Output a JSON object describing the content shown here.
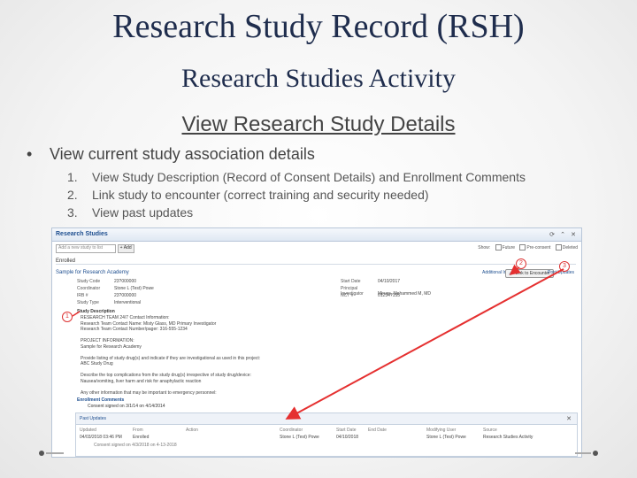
{
  "slide": {
    "title": "Research Study Record (RSH)",
    "subtitle": "Research Studies Activity",
    "section": "View Research Study Details",
    "bullet": "View current study association details",
    "items": [
      {
        "num": "1.",
        "text": "View Study Description (Record of Consent Details) and Enrollment Comments"
      },
      {
        "num": "2.",
        "text": "Link study to encounter (correct training and security needed)"
      },
      {
        "num": "3.",
        "text": "View past updates"
      }
    ]
  },
  "panel": {
    "title": "Research Studies",
    "refresh": "⟳",
    "collapse": "⌃",
    "close": "✕",
    "add_placeholder": "Add a new study to list",
    "add_label": "+ Add",
    "show_label": "Show:",
    "filters": [
      "Future",
      "Pre-consent",
      "Deleted"
    ],
    "enrolled": "Enrolled",
    "study_name": "Sample for Research Academy",
    "additional_info": "Additional Info",
    "link_encounter": "Link to Encounter",
    "post_updates": "Post Updates",
    "left_fields": [
      {
        "k": "Study Code",
        "v": "23?000000"
      },
      {
        "k": "Coordinator",
        "v": "Stone L (Test) Powe"
      },
      {
        "k": "IRB #",
        "v": "23?000000"
      },
      {
        "k": "Study Type",
        "v": "Interventional"
      }
    ],
    "right_fields": [
      {
        "k": "Start Date",
        "v": "04/10/2017"
      },
      {
        "k": "Principal Investigator",
        "v": "Mirves, Mohammed M, MD"
      },
      {
        "k": "NCT #",
        "v": "01234?155"
      }
    ],
    "desc_label": "Study Description",
    "desc_lines": [
      "RESEARCH TEAM 24/7 Contact Information:",
      "Research Team Contact Name: Misty Glass, MD Primary Investigator",
      "Research Team Contact Number/pager: 316-555-1234",
      "",
      "PROJECT INFORMATION:",
      "Sample for Research Academy",
      "",
      "Provide listing of study drug(s) and indicate if they are investigational as used in this project:",
      "ABC Study Drug",
      "",
      "Describe the top complications from the study drug(s) irrespective of study drug/device:",
      "Nausea/vomiting, liver harm and risk for anaphylactic reaction",
      "",
      "Any other information that may be important to emergency personnel:",
      "NA"
    ],
    "enroll_comments": "Enrollment Comments",
    "consent": "Consent signed on 3/1/14 on 4/14/2014",
    "past_updates": {
      "title": "Past Updates",
      "close": "✕",
      "columns": [
        "Updated",
        "From",
        "Action",
        "Coordinator",
        "Start Date",
        "End Date",
        "Modifying User",
        "Source"
      ],
      "values": [
        "04/03/2018 03:46 PM",
        "Enrolled",
        "",
        "Stone L (Test) Powe",
        "04/10/2018",
        "",
        "Stone L (Test) Powe",
        "Research Studies Activity"
      ],
      "extra": "Consent signed on 4/3/2018 on 4-13-2018"
    },
    "callouts": [
      "1",
      "2",
      "3"
    ]
  }
}
